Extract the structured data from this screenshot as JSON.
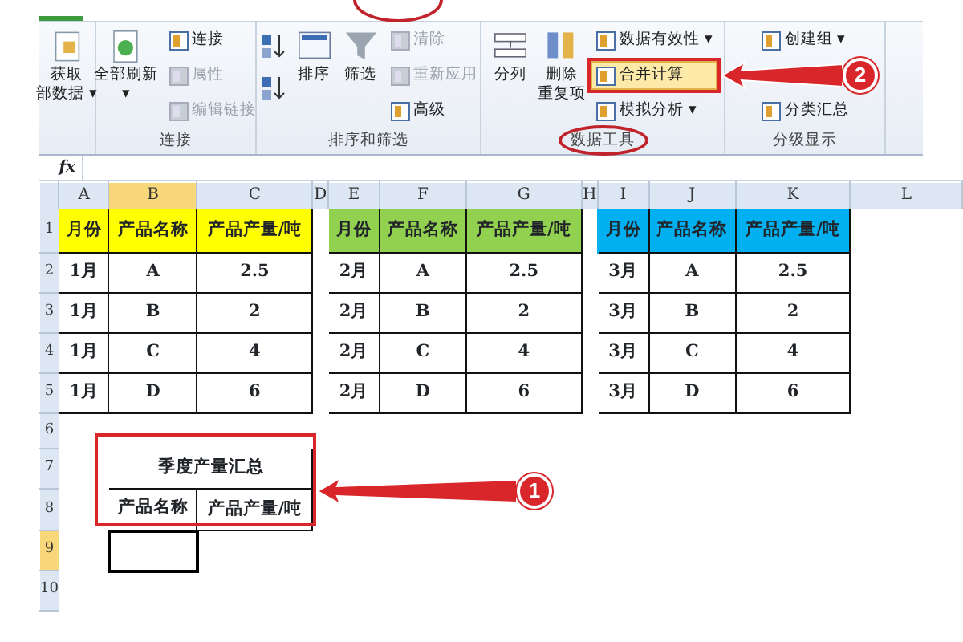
{
  "ribbon": {
    "groups": [
      {
        "items": [
          {
            "kind": "large",
            "lines": [
              "获取",
              "部数据"
            ],
            "caret": "▾",
            "disabled": false
          }
        ]
      },
      {
        "label": "连接",
        "items": [
          {
            "kind": "large",
            "lines": [
              "全部刷新"
            ],
            "caret": "▾",
            "disabled": false
          },
          {
            "kind": "stack",
            "items": [
              {
                "label": "连接",
                "disabled": false
              },
              {
                "label": "属性",
                "disabled": true
              },
              {
                "label": "编辑链接",
                "disabled": true
              }
            ]
          }
        ]
      },
      {
        "label": "排序和筛选",
        "items": [
          {
            "kind": "sorticons"
          },
          {
            "kind": "large",
            "lines": [
              "排序"
            ],
            "disabled": false
          },
          {
            "kind": "large",
            "lines": [
              "筛选"
            ],
            "disabled": false
          },
          {
            "kind": "stack",
            "items": [
              {
                "label": "清除",
                "disabled": true
              },
              {
                "label": "重新应用",
                "disabled": true
              },
              {
                "label": "高级",
                "disabled": false
              }
            ]
          }
        ]
      },
      {
        "label": "数据工具",
        "items": [
          {
            "kind": "large",
            "lines": [
              "分列"
            ],
            "disabled": false
          },
          {
            "kind": "large",
            "lines": [
              "删除",
              "重复项"
            ],
            "disabled": false
          },
          {
            "kind": "stack",
            "items": [
              {
                "label": "数据有效性",
                "caret": "▾",
                "disabled": false
              },
              {
                "label": "合并计算",
                "disabled": false,
                "highlighted": true
              },
              {
                "label": "模拟分析",
                "caret": "▾",
                "disabled": false
              }
            ]
          }
        ]
      },
      {
        "label": "分级显示",
        "items": [
          {
            "kind": "stack",
            "items": [
              {
                "label": "创建组",
                "caret": "▾",
                "disabled": false
              },
              {
                "kind": "spacer"
              },
              {
                "label": "分类汇总",
                "disabled": false
              }
            ]
          }
        ]
      }
    ]
  },
  "formula_bar": {
    "function_label": "fx"
  },
  "sheet": {
    "columns": [
      {
        "label": "A",
        "selected": false
      },
      {
        "label": "B",
        "selected": true
      },
      {
        "label": "C",
        "selected": false
      },
      {
        "label": "D",
        "selected": false
      },
      {
        "label": "E",
        "selected": false
      },
      {
        "label": "F",
        "selected": false
      },
      {
        "label": "G",
        "selected": false
      },
      {
        "label": "H",
        "selected": false
      },
      {
        "label": "I",
        "selected": false
      },
      {
        "label": "J",
        "selected": false
      },
      {
        "label": "K",
        "selected": false
      },
      {
        "label": "L",
        "selected": false
      }
    ],
    "row_numbers": [
      {
        "label": "1",
        "selected": false
      },
      {
        "label": "2",
        "selected": false
      },
      {
        "label": "3",
        "selected": false
      },
      {
        "label": "4",
        "selected": false
      },
      {
        "label": "5",
        "selected": false
      },
      {
        "label": "6",
        "selected": false
      },
      {
        "label": "7",
        "selected": false
      },
      {
        "label": "8",
        "selected": false
      },
      {
        "label": "9",
        "selected": true
      },
      {
        "label": "10",
        "selected": false
      }
    ],
    "tables": [
      {
        "color": "#ffff00",
        "headers": [
          "月份",
          "产品名称",
          "产品产量/吨"
        ],
        "rows": [
          [
            "1月",
            "A",
            "2.5"
          ],
          [
            "1月",
            "B",
            "2"
          ],
          [
            "1月",
            "C",
            "4"
          ],
          [
            "1月",
            "D",
            "6"
          ]
        ]
      },
      {
        "color": "#92d050",
        "headers": [
          "月份",
          "产品名称",
          "产品产量/吨"
        ],
        "rows": [
          [
            "2月",
            "A",
            "2.5"
          ],
          [
            "2月",
            "B",
            "2"
          ],
          [
            "2月",
            "C",
            "4"
          ],
          [
            "2月",
            "D",
            "6"
          ]
        ]
      },
      {
        "color": "#00b0f0",
        "headers": [
          "月份",
          "产品名称",
          "产品产量/吨"
        ],
        "rows": [
          [
            "3月",
            "A",
            "2.5"
          ],
          [
            "3月",
            "B",
            "2"
          ],
          [
            "3月",
            "C",
            "4"
          ],
          [
            "3月",
            "D",
            "6"
          ]
        ]
      }
    ],
    "summary": {
      "title": "季度产量汇总",
      "headers": [
        "产品名称",
        "产品产量/吨"
      ]
    }
  },
  "annotations": [
    {
      "label": "2"
    },
    {
      "label": "1"
    }
  ]
}
